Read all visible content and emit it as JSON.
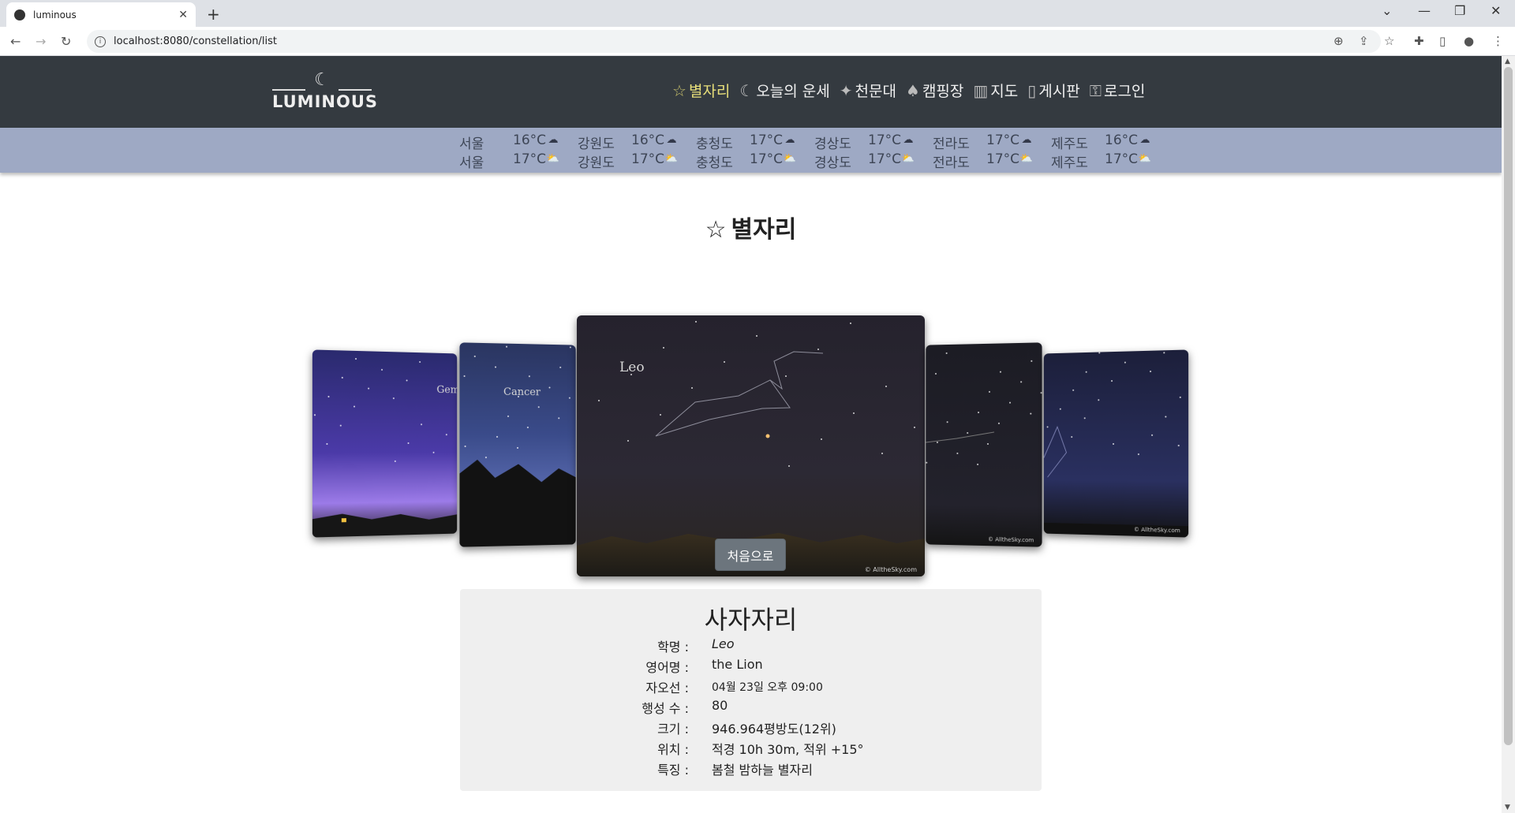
{
  "browser": {
    "tab_title": "luminous",
    "tab_close": "✕",
    "new_tab": "+",
    "url": "localhost:8080/constellation/list",
    "window_controls": [
      "⌄",
      "—",
      "❐",
      "✕"
    ]
  },
  "site": {
    "logo_text": "LUMINOUS",
    "logo_mark": "☾",
    "menu": [
      {
        "label": "별자리",
        "icon": "☆",
        "active": true
      },
      {
        "label": "오늘의 운세",
        "icon": "☾"
      },
      {
        "label": "천문대",
        "icon": "✦"
      },
      {
        "label": "캠핑장",
        "icon": "♠"
      },
      {
        "label": "지도",
        "icon": "▥"
      },
      {
        "label": "게시판",
        "icon": "▯"
      },
      {
        "label": "로그인",
        "icon": "⚿"
      }
    ]
  },
  "weather": {
    "today": [
      {
        "region": "서울",
        "temp": "16°C",
        "icon": "rain"
      },
      {
        "region": "강원도",
        "temp": "16°C",
        "icon": "rain"
      },
      {
        "region": "충청도",
        "temp": "17°C",
        "icon": "rain"
      },
      {
        "region": "경상도",
        "temp": "17°C",
        "icon": "rain"
      },
      {
        "region": "전라도",
        "temp": "17°C",
        "icon": "rain"
      },
      {
        "region": "제주도",
        "temp": "16°C",
        "icon": "rain"
      }
    ],
    "tomorrow": [
      {
        "region": "서울",
        "temp": "17°C",
        "icon": "sun"
      },
      {
        "region": "강원도",
        "temp": "17°C",
        "icon": "sun"
      },
      {
        "region": "충청도",
        "temp": "17°C",
        "icon": "sun"
      },
      {
        "region": "경상도",
        "temp": "17°C",
        "icon": "sun"
      },
      {
        "region": "전라도",
        "temp": "17°C",
        "icon": "sun"
      },
      {
        "region": "제주도",
        "temp": "17°C",
        "icon": "sun"
      }
    ]
  },
  "section_title": "별자리",
  "section_icon": "☆",
  "carousel": {
    "slides": [
      {
        "label": "Gem"
      },
      {
        "label": "Cancer"
      },
      {
        "label": "Leo",
        "credit": "© AlltheSky.com"
      },
      {
        "label": "",
        "credit": "© AlltheSky.com"
      },
      {
        "label": "",
        "credit": "© AlltheSky.com"
      }
    ]
  },
  "first_button": "처음으로",
  "constellation": {
    "name": "사자자리",
    "rows": [
      {
        "key": "학명 :",
        "value": "Leo",
        "style": "italic"
      },
      {
        "key": "영어명 :",
        "value": "the Lion"
      },
      {
        "key": "자오선 :",
        "value": "04월 23일 오후 09:00",
        "style": "small"
      },
      {
        "key": "행성 수 :",
        "value": "80"
      },
      {
        "key": "크기 :",
        "value": "946.964평방도(12위)"
      },
      {
        "key": "위치 :",
        "value": "적경 10h 30m, 적위 +15°"
      },
      {
        "key": "특징 :",
        "value": "봄철 밤하늘 별자리"
      }
    ]
  }
}
